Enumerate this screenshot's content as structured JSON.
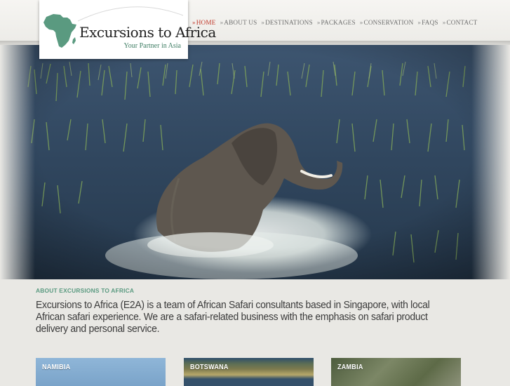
{
  "logo": {
    "title": "Excursions to Africa",
    "tagline": "Your Partner in Asia",
    "icon": "africa-map-icon",
    "accent": "#5a9a80"
  },
  "nav": {
    "chevron": "»",
    "items": [
      {
        "label": "HOME",
        "active": true
      },
      {
        "label": "ABOUT US"
      },
      {
        "label": "DESTINATIONS"
      },
      {
        "label": "PACKAGES"
      },
      {
        "label": "CONSERVATION"
      },
      {
        "label": "FAQS"
      },
      {
        "label": "CONTACT"
      }
    ],
    "active_color": "#c0392b"
  },
  "hero": {
    "image": "elephant-wading-through-river-photo"
  },
  "about": {
    "heading": "ABOUT EXCURSIONS TO AFRICA",
    "text": "Excursions to Africa (E2A) is a team of African Safari consultants based in Singapore, with local African safari experience. We are a safari-related business with the emphasis on safari product delivery and personal service."
  },
  "destinations": [
    {
      "label": "NAMIBIA"
    },
    {
      "label": "BOTSWANA"
    },
    {
      "label": "ZAMBIA"
    }
  ]
}
